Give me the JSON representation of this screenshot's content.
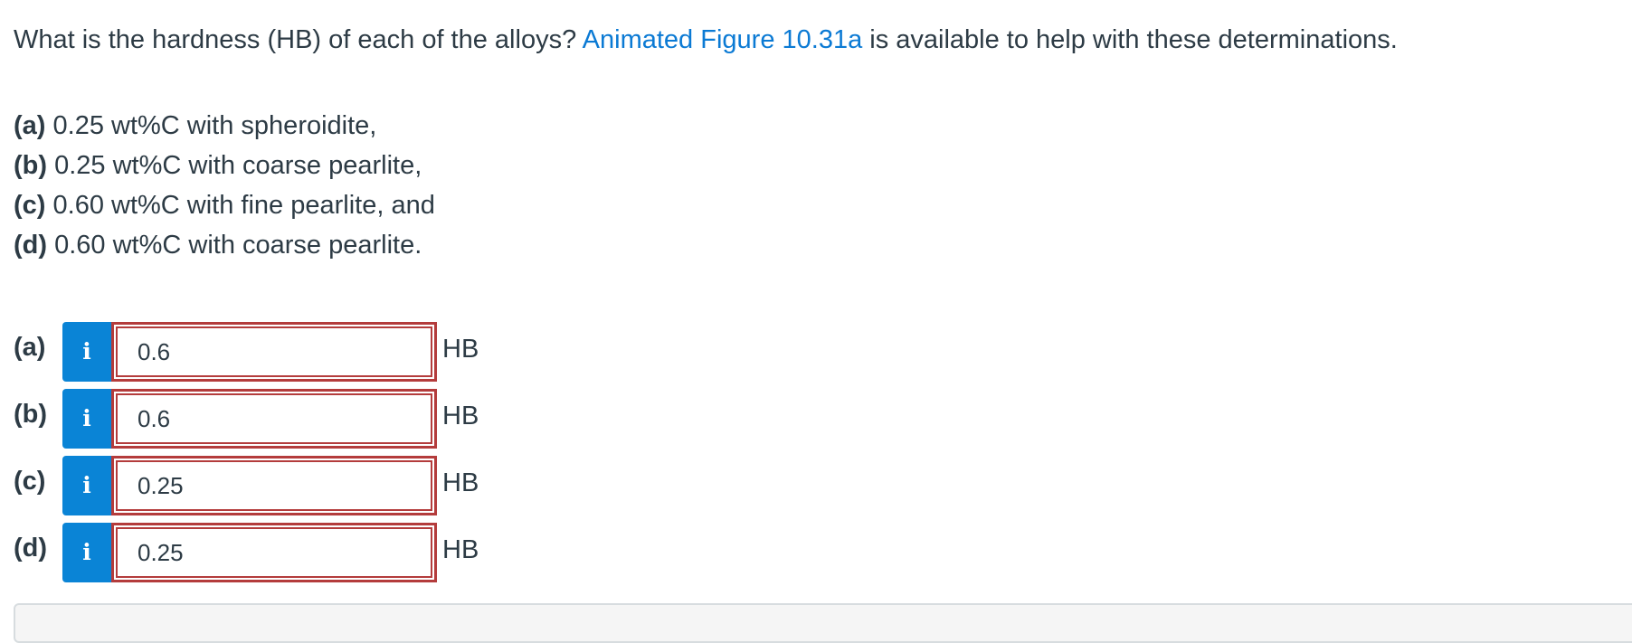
{
  "question": {
    "prefix": "What is the hardness (HB) of each of the alloys?",
    "link_text": "Animated Figure 10.31a",
    "suffix": "is available to help with these determinations."
  },
  "parts": [
    {
      "label": "(a)",
      "text": "0.25 wt%C with spheroidite,"
    },
    {
      "label": "(b)",
      "text": "0.25 wt%C with coarse pearlite,"
    },
    {
      "label": "(c)",
      "text": "0.60 wt%C with fine pearlite, and"
    },
    {
      "label": "(d)",
      "text": "0.60 wt%C with coarse pearlite."
    }
  ],
  "answers": [
    {
      "label": "(a)",
      "info_icon": "i",
      "value": "0.6",
      "unit": "HB"
    },
    {
      "label": "(b)",
      "info_icon": "i",
      "value": "0.6",
      "unit": "HB"
    },
    {
      "label": "(c)",
      "info_icon": "i",
      "value": "0.25",
      "unit": "HB"
    },
    {
      "label": "(d)",
      "info_icon": "i",
      "value": "0.25",
      "unit": "HB"
    }
  ],
  "colors": {
    "link": "#0b7ad4",
    "info_button": "#0a84d6",
    "error_border": "#b43c3c",
    "text": "#2d3b45"
  }
}
